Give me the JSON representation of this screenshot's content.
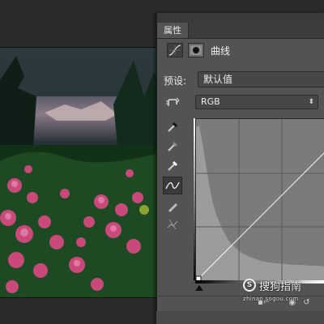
{
  "panel": {
    "tab_label": "属性",
    "adjustment_title": "曲线",
    "preset_label": "预设:",
    "preset_value": "默认值",
    "channel_value": "RGB",
    "channel_arrow": "⬍"
  },
  "tools": [
    {
      "name": "on-image-adjust-icon"
    },
    {
      "name": "black-point-eyedropper-icon"
    },
    {
      "name": "gray-point-eyedropper-icon"
    },
    {
      "name": "white-point-eyedropper-icon"
    },
    {
      "name": "curve-point-tool-icon"
    },
    {
      "name": "pencil-draw-icon"
    },
    {
      "name": "smooth-curve-icon"
    }
  ],
  "watermark": {
    "logo_glyph": "S",
    "text": "搜狗指南",
    "url": "zhinan.sogou.com"
  },
  "colors": {
    "panel_bg": "#535353",
    "graph_bg": "#7b7b7b",
    "histogram": "#9c9c9c"
  }
}
